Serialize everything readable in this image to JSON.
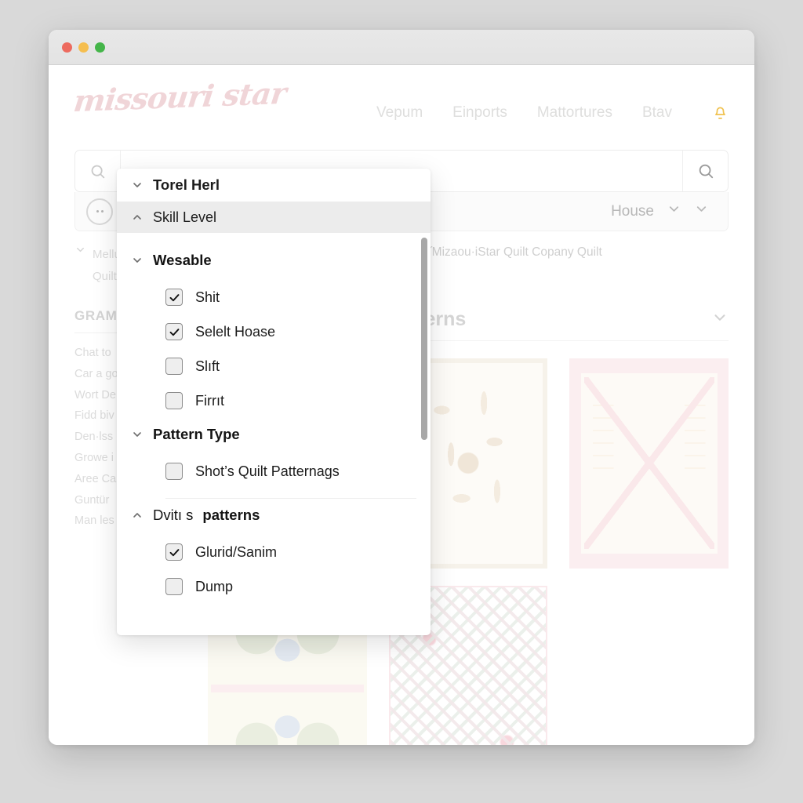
{
  "window": {
    "traffic_lights": [
      {
        "name": "close",
        "color": "#ed6a5e"
      },
      {
        "name": "minimize",
        "color": "#f5be4f"
      },
      {
        "name": "zoom",
        "color": "#44b549"
      }
    ]
  },
  "header": {
    "logo_text": "missouri star",
    "nav": [
      {
        "label": "Vepum"
      },
      {
        "label": "Einports"
      },
      {
        "label": "Mattortures"
      },
      {
        "label": "Btav"
      }
    ],
    "bell_icon": "bell-icon",
    "bell_color": "#f0b429"
  },
  "search": {
    "value": "",
    "placeholder": "",
    "lead_icon": "search-icon",
    "go_icon": "search-icon"
  },
  "subbar": {
    "round_icon": "more-dots-icon",
    "select_label": "House",
    "chevron_1": "chevron-down-icon",
    "chevron_2": "chevron-down-icon"
  },
  "breadcrumb": {
    "left_line_1": "Mellu",
    "left_line_2": "Quilt",
    "right_text": "ear Statın ˝Mizaou·iStar Quilt Copany Quilt"
  },
  "sidebar": {
    "title": "GRAM",
    "items": [
      {
        "label": "Chat to"
      },
      {
        "label": "Car a go"
      },
      {
        "label": "Wort De"
      },
      {
        "label": "Fidd biv"
      },
      {
        "label": "Den·lss"
      },
      {
        "label": "Growe i"
      },
      {
        "label": "Aree Ca"
      },
      {
        "label": "Guntür"
      },
      {
        "label": "Man les"
      }
    ]
  },
  "main": {
    "title": "x Balionr Free Quilt Paterns",
    "collapse_icon": "chevron-down-icon",
    "cards": [
      {
        "art": "q1"
      },
      {
        "art": "q2"
      },
      {
        "art": "q3"
      },
      {
        "art": "q4"
      },
      {
        "art": "q5"
      }
    ]
  },
  "panel": {
    "header_rows": [
      {
        "label": "Torel Herl",
        "icon": "chevron-down-icon",
        "expanded": false,
        "active": false
      },
      {
        "label": "Skill Level",
        "icon": "chevron-up-icon",
        "expanded": true,
        "active": true
      }
    ],
    "groups": [
      {
        "title": "Wesable",
        "title_bold": true,
        "icon": "chevron-down-icon",
        "options": [
          {
            "label": "Shit",
            "checked": true
          },
          {
            "label": "Selelt Hoase",
            "checked": true
          },
          {
            "label": "Slıft",
            "checked": false
          },
          {
            "label": "Firrıt",
            "checked": false
          }
        ]
      },
      {
        "title": "Pattern Type",
        "title_bold": true,
        "icon": "chevron-down-icon",
        "options": [
          {
            "label": "Shot’s Quilt Patternags",
            "checked": false
          }
        ]
      },
      {
        "title_prefix": "Dvitı s ",
        "title_strong": "patterns",
        "title_bold": false,
        "icon": "chevron-up-icon",
        "options": [
          {
            "label": "Glurid/Sanim",
            "checked": true
          },
          {
            "label": "Dump",
            "checked": false
          }
        ]
      }
    ],
    "scrollbar": {
      "name": "panel-scrollbar",
      "position_pct": 0
    }
  }
}
